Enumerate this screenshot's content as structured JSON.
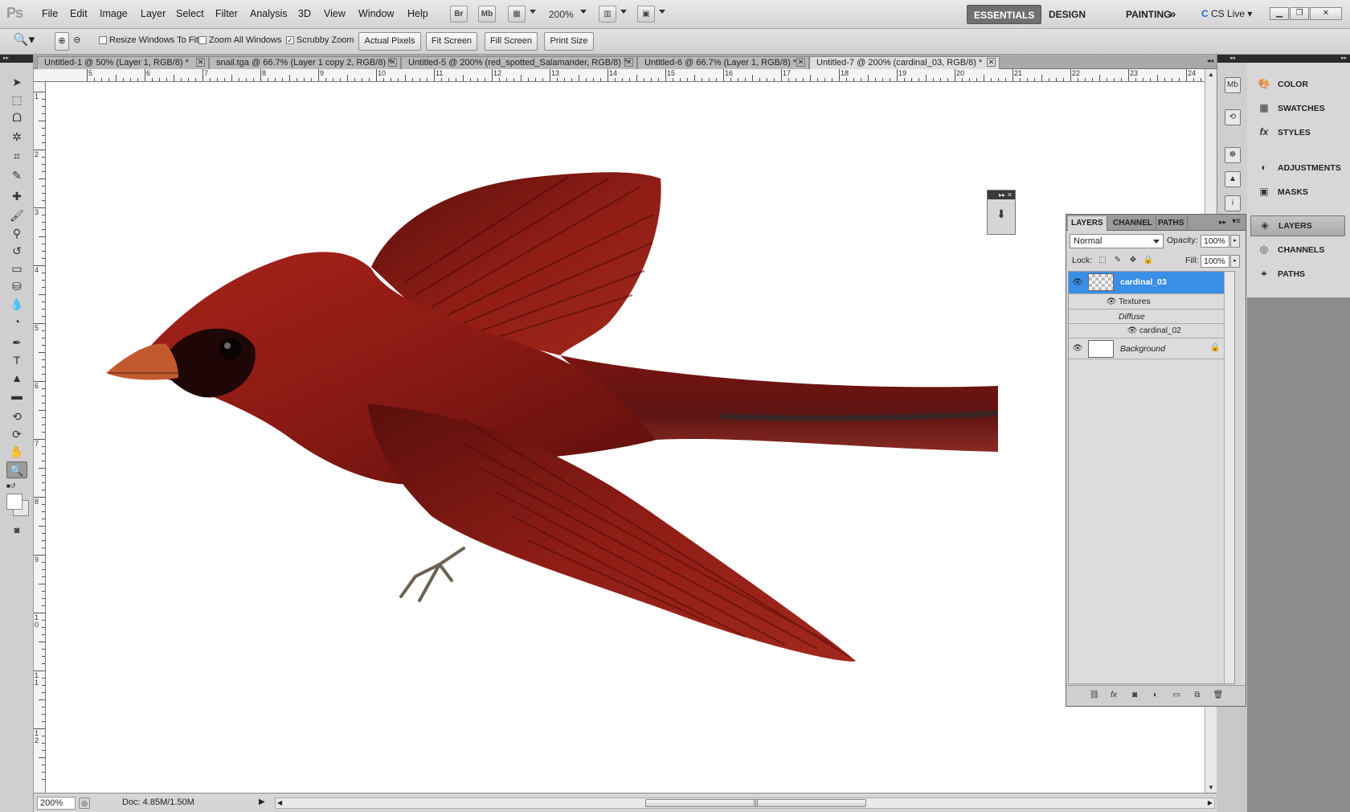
{
  "app": {
    "logo": "Ps"
  },
  "menu": [
    "File",
    "Edit",
    "Image",
    "Layer",
    "Select",
    "Filter",
    "Analysis",
    "3D",
    "View",
    "Window",
    "Help"
  ],
  "app_bar": {
    "bridge": "Br",
    "mini_bridge": "Mb",
    "zoom": "200%"
  },
  "workspaces": {
    "essentials": "ESSENTIALS",
    "design": "DESIGN",
    "painting": "PAINTING",
    "more": "»"
  },
  "cs_live": "CS Live",
  "options": {
    "resize_windows": {
      "label": "Resize Windows To Fit",
      "checked": false
    },
    "zoom_all": {
      "label": "Zoom All Windows",
      "checked": false
    },
    "scrubby": {
      "label": "Scrubby Zoom",
      "checked": true
    },
    "actual_pixels": "Actual Pixels",
    "fit_screen": "Fit Screen",
    "fill_screen": "Fill Screen",
    "print_size": "Print Size"
  },
  "doc_tabs": [
    {
      "title": "Untitled-1 @ 50% (Layer 1, RGB/8) *"
    },
    {
      "title": "snail.tga @ 66.7% (Layer 1 copy 2, RGB/8) *"
    },
    {
      "title": "Untitled-5 @ 200% (red_spotted_Salamander, RGB/8) *"
    },
    {
      "title": "Untitled-6 @ 66.7% (Layer 1, RGB/8) *"
    },
    {
      "title": "Untitled-7 @ 200% (cardinal_03, RGB/8) *"
    }
  ],
  "ruler_top": [
    "5",
    "6",
    "7",
    "8",
    "9",
    "10",
    "11",
    "12",
    "13",
    "14",
    "15",
    "16",
    "17",
    "18",
    "19",
    "20",
    "21",
    "22",
    "23",
    "24"
  ],
  "ruler_left": [
    "1",
    "2",
    "3",
    "4",
    "5",
    "6",
    "7",
    "8",
    "9",
    "10",
    "11",
    "12"
  ],
  "status": {
    "zoom": "200%",
    "doc": "Doc: 4.85M/1.50M"
  },
  "dock": {
    "color": "COLOR",
    "swatches": "SWATCHES",
    "styles": "STYLES",
    "adjustments": "ADJUSTMENTS",
    "masks": "MASKS",
    "layers": "LAYERS",
    "channels": "CHANNELS",
    "paths": "PATHS"
  },
  "layers_panel": {
    "tabs": [
      "LAYERS",
      "CHANNEL",
      "PATHS"
    ],
    "blend_mode": "Normal",
    "opacity_label": "Opacity:",
    "opacity": "100%",
    "lock_label": "Lock:",
    "fill_label": "Fill:",
    "fill": "100%",
    "layers": [
      {
        "name": "cardinal_03",
        "selected": true
      },
      {
        "name": "Textures"
      },
      {
        "name": "Diffuse"
      },
      {
        "name": "cardinal_02"
      },
      {
        "name": "Background",
        "locked": true
      }
    ]
  },
  "colors": {
    "selection": "#3a8ee6",
    "bird_red": "#8e1a14",
    "canvas": "#ffffff"
  }
}
